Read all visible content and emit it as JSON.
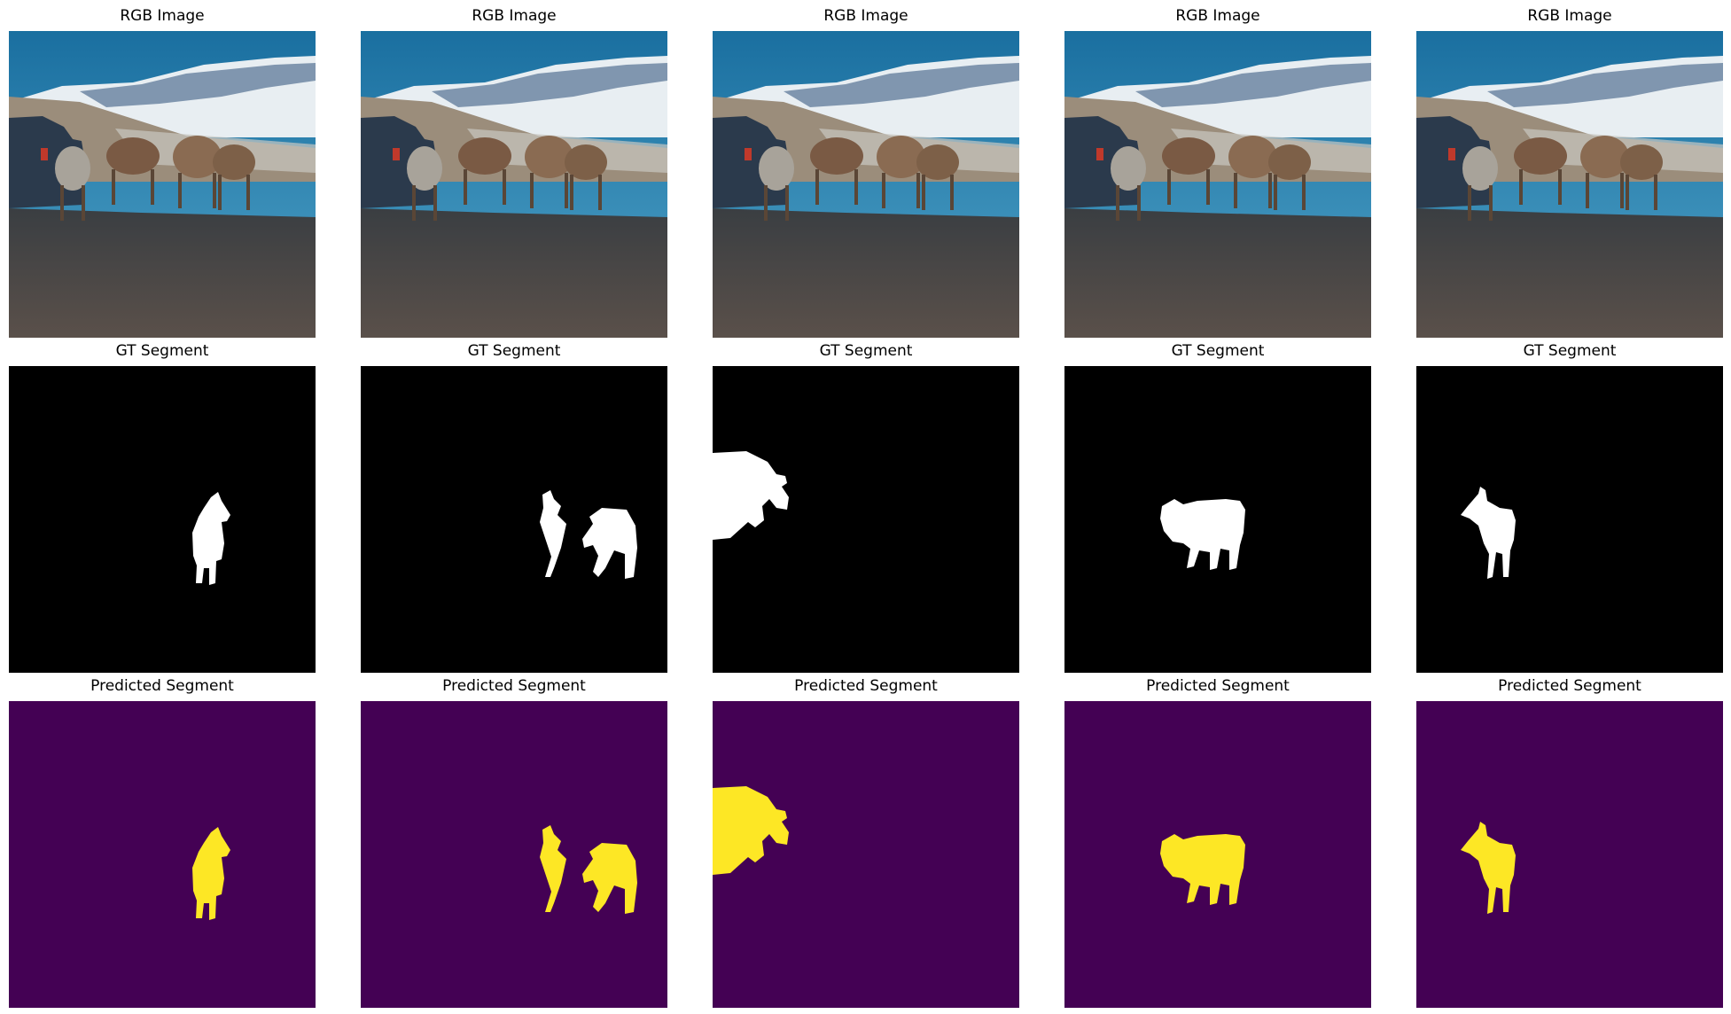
{
  "figure": {
    "rows": [
      {
        "key": "rgb",
        "titles": [
          "RGB Image",
          "RGB Image",
          "RGB Image",
          "RGB Image",
          "RGB Image"
        ],
        "style": "photo"
      },
      {
        "key": "gt",
        "titles": [
          "GT Segment",
          "GT Segment",
          "GT Segment",
          "GT Segment",
          "GT Segment"
        ],
        "style": "binary-mask"
      },
      {
        "key": "pred",
        "titles": [
          "Predicted Segment",
          "Predicted Segment",
          "Predicted Segment",
          "Predicted Segment",
          "Predicted Segment"
        ],
        "style": "color-mask"
      }
    ],
    "colors": {
      "gt_background": "#000000",
      "gt_foreground": "#ffffff",
      "pred_background": "#440154",
      "pred_foreground": "#fde725"
    },
    "mask_targets": [
      "small-sheep-center",
      "two-sheep-right",
      "vehicle-left",
      "large-sheep-middle",
      "small-sheep-left"
    ]
  }
}
